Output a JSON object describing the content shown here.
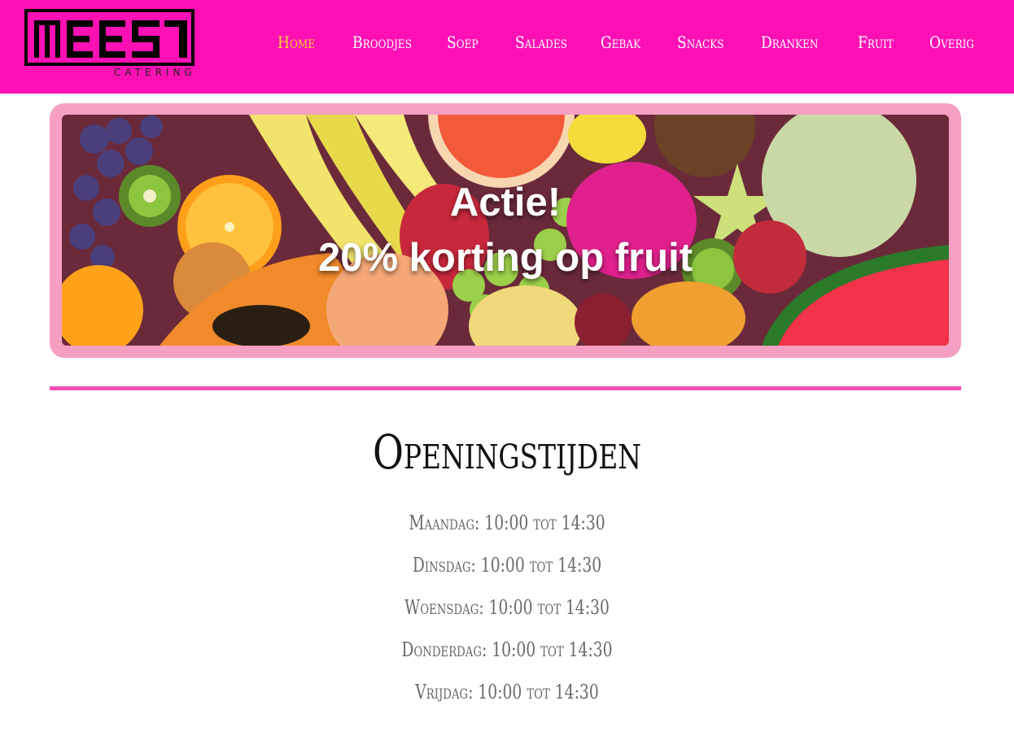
{
  "header": {
    "logo_text": "MEES",
    "logo_subtext": "CATERING",
    "brand_color": "#ff10b4",
    "nav": [
      {
        "label": "Home",
        "active": true
      },
      {
        "label": "Broodjes",
        "active": false
      },
      {
        "label": "Soep",
        "active": false
      },
      {
        "label": "Salades",
        "active": false
      },
      {
        "label": "Gebak",
        "active": false
      },
      {
        "label": "Snacks",
        "active": false
      },
      {
        "label": "Dranken",
        "active": false
      },
      {
        "label": "Fruit",
        "active": false
      },
      {
        "label": "Overig",
        "active": false
      }
    ],
    "active_color": "#ffd23a"
  },
  "banner": {
    "line1": "Actie!",
    "line2": "20% korting op fruit",
    "image": "fruit-photo",
    "frame_color": "#f5a0c2"
  },
  "divider_color": "#f24fb7",
  "hours": {
    "title": "Openingstijden",
    "rows": [
      "Maandag: 10:00 tot 14:30",
      "Dinsdag: 10:00 tot 14:30",
      "Woensdag: 10:00 tot 14:30",
      "Donderdag: 10:00 tot 14:30",
      "Vrijdag: 10:00 tot 14:30"
    ]
  }
}
